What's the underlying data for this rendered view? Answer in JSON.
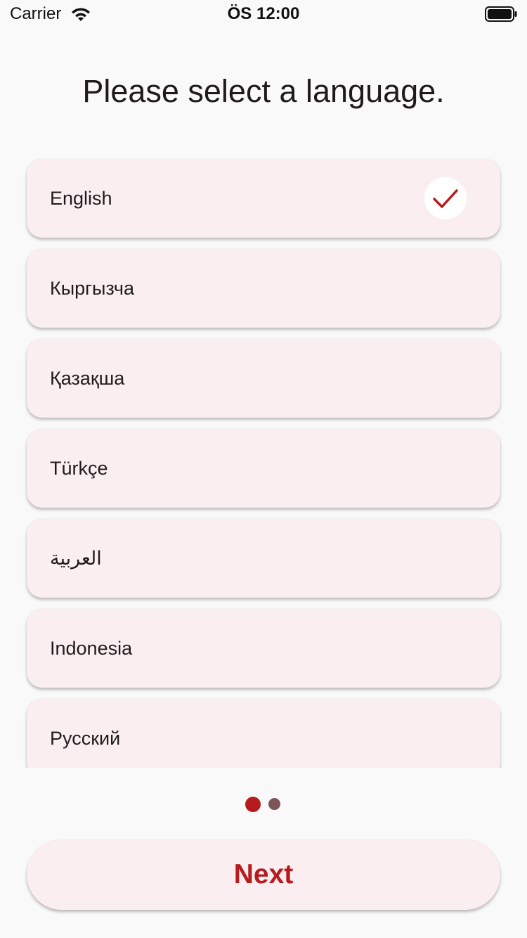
{
  "status_bar": {
    "carrier": "Carrier",
    "time": "ÖS 12:00",
    "wifi_icon": "wifi-icon",
    "battery_icon": "battery-icon"
  },
  "title": "Please select a language.",
  "languages": [
    {
      "label": "English",
      "selected": true
    },
    {
      "label": "Кыргызча",
      "selected": false
    },
    {
      "label": "Қазақша",
      "selected": false
    },
    {
      "label": "Türkçe",
      "selected": false
    },
    {
      "label": "العربية",
      "selected": false
    },
    {
      "label": "Indonesia",
      "selected": false
    },
    {
      "label": "Русский",
      "selected": false
    }
  ],
  "pagination": {
    "current_page": 1,
    "total_pages": 2
  },
  "next_button_label": "Next",
  "colors": {
    "accent": "#b61b1e",
    "card_background": "#fbeef1",
    "page_background": "#f9f9f9",
    "inactive_dot": "#7b5557"
  }
}
